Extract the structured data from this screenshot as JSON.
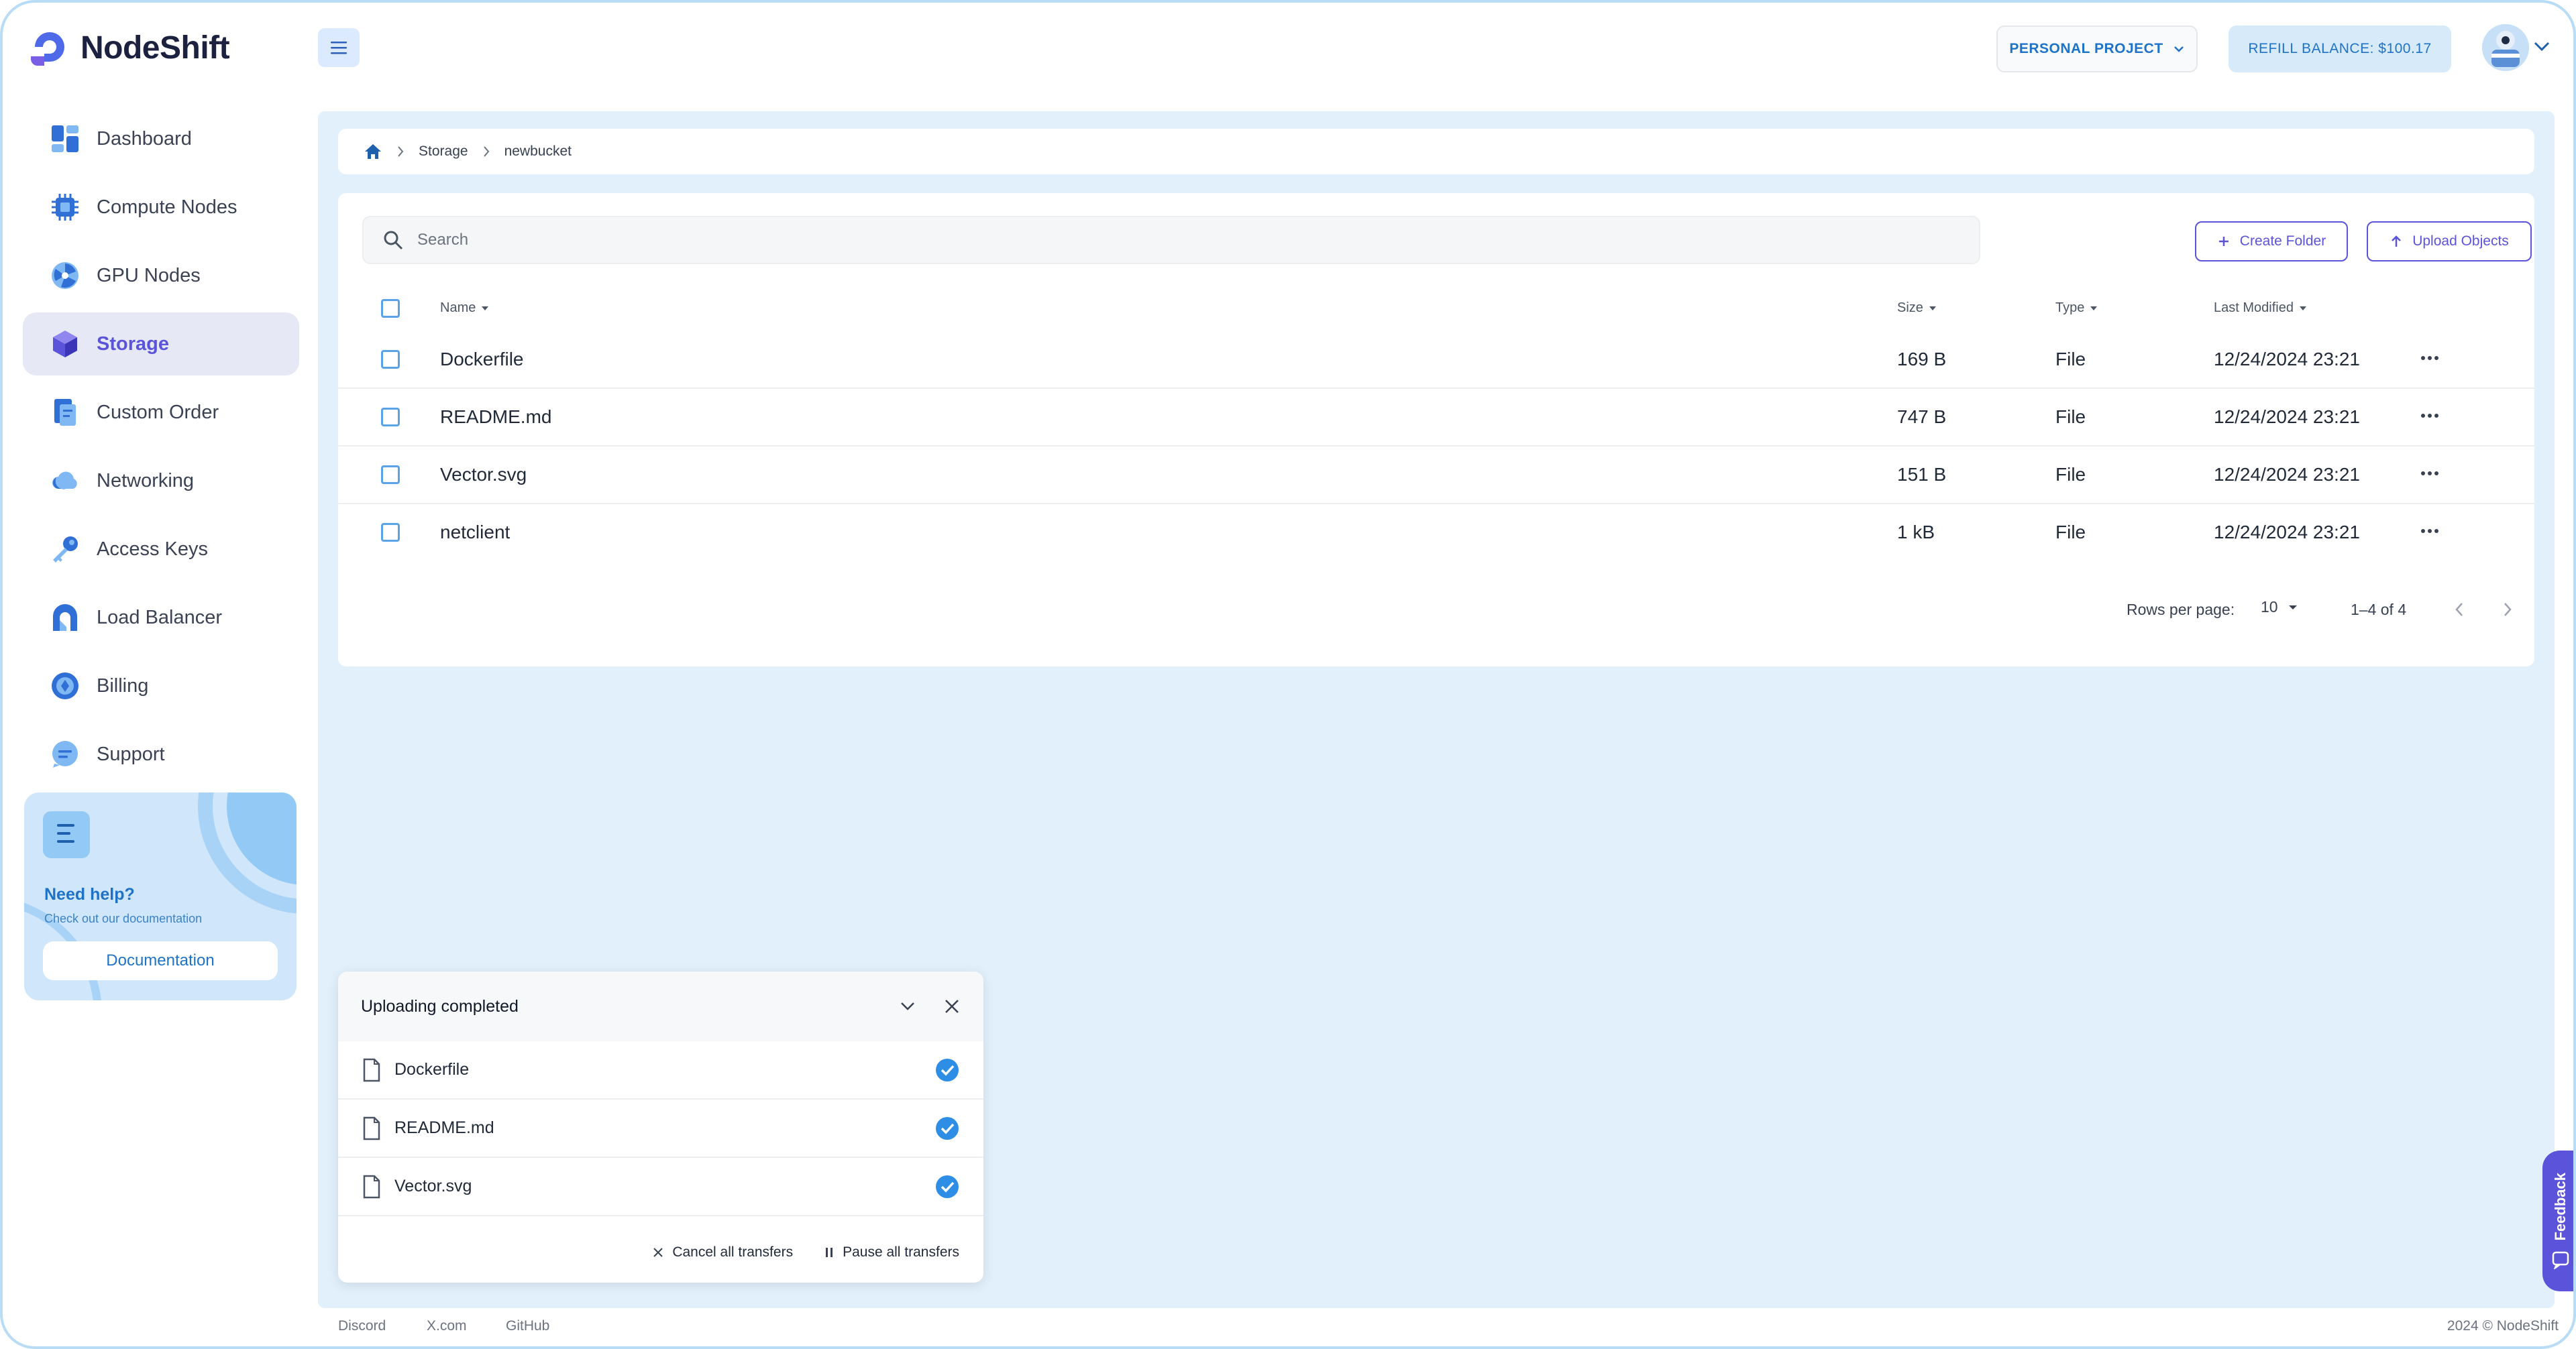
{
  "brand": {
    "name": "NodeShift"
  },
  "sidebar": {
    "items": [
      {
        "label": "Dashboard"
      },
      {
        "label": "Compute Nodes"
      },
      {
        "label": "GPU Nodes"
      },
      {
        "label": "Storage"
      },
      {
        "label": "Custom Order"
      },
      {
        "label": "Networking"
      },
      {
        "label": "Access Keys"
      },
      {
        "label": "Load Balancer"
      },
      {
        "label": "Billing"
      },
      {
        "label": "Support"
      }
    ],
    "active": "Storage",
    "help": {
      "title": "Need help?",
      "subtitle": "Check out our documentation",
      "button": "Documentation"
    }
  },
  "header": {
    "project": "PERSONAL PROJECT",
    "refill": "REFILL BALANCE: $100.17"
  },
  "breadcrumb": {
    "items": [
      "Storage",
      "newbucket"
    ]
  },
  "toolbar": {
    "search_placeholder": "Search",
    "create_folder": "Create Folder",
    "upload_objects": "Upload Objects"
  },
  "table": {
    "columns": {
      "name": "Name",
      "size": "Size",
      "type": "Type",
      "modified": "Last Modified"
    },
    "rows": [
      {
        "name": "Dockerfile",
        "size": "169 B",
        "type": "File",
        "modified": "12/24/2024 23:21"
      },
      {
        "name": "README.md",
        "size": "747 B",
        "type": "File",
        "modified": "12/24/2024 23:21"
      },
      {
        "name": "Vector.svg",
        "size": "151 B",
        "type": "File",
        "modified": "12/24/2024 23:21"
      },
      {
        "name": "netclient",
        "size": "1 kB",
        "type": "File",
        "modified": "12/24/2024 23:21"
      }
    ],
    "pagination": {
      "rows_label": "Rows per page:",
      "rows_value": "10",
      "range": "1–4 of 4"
    }
  },
  "upload_panel": {
    "title": "Uploading completed",
    "files": [
      {
        "name": "Dockerfile"
      },
      {
        "name": "README.md"
      },
      {
        "name": "Vector.svg"
      }
    ],
    "cancel_all": "Cancel all transfers",
    "pause_all": "Pause all transfers"
  },
  "footer": {
    "links": [
      "Discord",
      "X.com",
      "GitHub"
    ],
    "copyright": "2024 © NodeShift"
  },
  "feedback": {
    "label": "Feedback"
  },
  "colors": {
    "accent": "#5b53d9",
    "primary_blue": "#1e73c9",
    "panel_bg": "#e2f0fc"
  }
}
